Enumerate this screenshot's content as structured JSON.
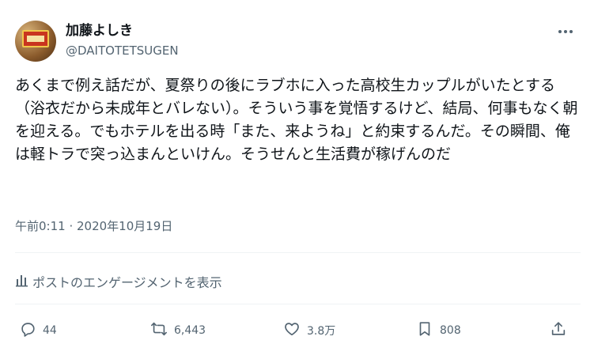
{
  "author": {
    "display_name": "加藤よしき",
    "handle": "@DAITOTETSUGEN"
  },
  "tweet": {
    "text": "あくまで例え話だが、夏祭りの後にラブホに入った高校生カップルがいたとする（浴衣だから未成年とバレない）。そういう事を覚悟するけど、結局、何事もなく朝を迎える。でもホテルを出る時「また、来ようね」と約束するんだ。その瞬間、俺は軽トラで突っ込まんといけん。そうせんと生活費が稼げんのだ",
    "timestamp": "午前0:11 · 2020年10月19日"
  },
  "engagement": {
    "label": "ポストのエンゲージメントを表示"
  },
  "actions": {
    "replies": "44",
    "reposts": "6,443",
    "likes": "3.8万",
    "bookmarks": "808"
  },
  "icons": {
    "more": "more-horizontal-icon",
    "engagement": "analytics-icon",
    "reply": "reply-icon",
    "repost": "repost-icon",
    "like": "heart-icon",
    "bookmark": "bookmark-icon",
    "share": "share-icon"
  },
  "colors": {
    "text_primary": "#0f1419",
    "text_secondary": "#536471",
    "divider": "#eff3f4"
  }
}
